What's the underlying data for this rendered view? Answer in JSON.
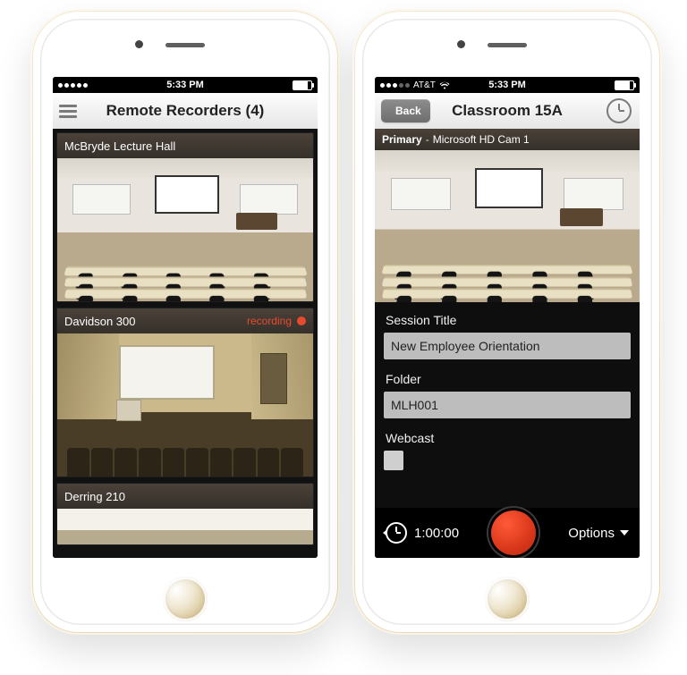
{
  "left": {
    "status": {
      "carrier": "",
      "time": "5:33 PM",
      "wifi": false
    },
    "navbar": {
      "title": "Remote Recorders (4)",
      "menu_icon": "hamburger-icon"
    },
    "recorders": [
      {
        "name": "McBryde Lecture Hall",
        "recording": false
      },
      {
        "name": "Davidson 300",
        "recording": true,
        "recording_label": "recording"
      },
      {
        "name": "Derring 210",
        "recording": false
      }
    ]
  },
  "right": {
    "status": {
      "carrier": "AT&T",
      "time": "5:33 PM",
      "wifi": true
    },
    "navbar": {
      "back_label": "Back",
      "title": "Classroom 15A",
      "clock_icon": "clock-icon"
    },
    "source": {
      "tag": "Primary",
      "name": "Microsoft HD Cam 1"
    },
    "form": {
      "session_title_label": "Session Title",
      "session_title_value": "New Employee Orientation",
      "folder_label": "Folder",
      "folder_value": "MLH001",
      "webcast_label": "Webcast",
      "webcast_checked": false
    },
    "bottom": {
      "duration": "1:00:00",
      "options_label": "Options"
    }
  }
}
